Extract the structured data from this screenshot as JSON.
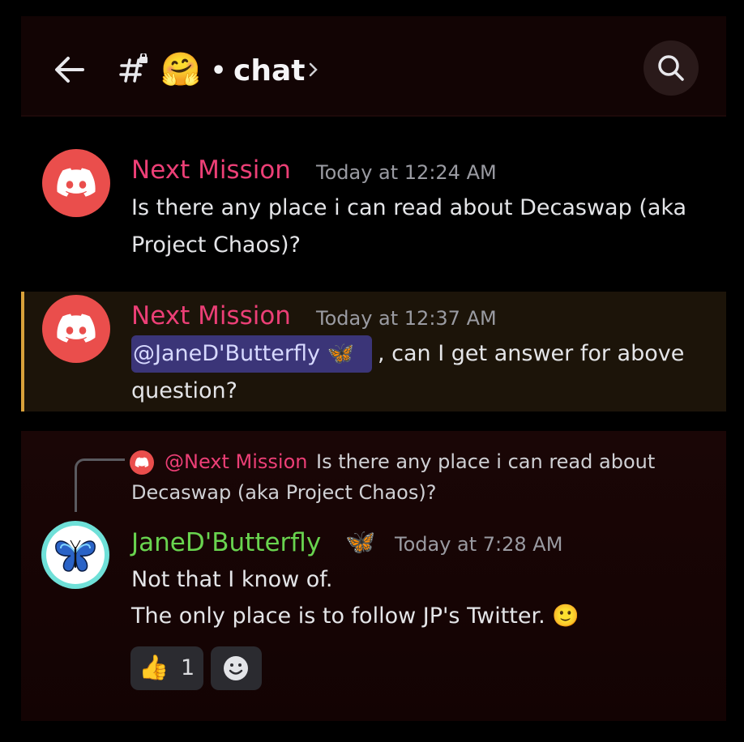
{
  "header": {
    "back_icon": "arrow-left-icon",
    "channel_icon": "hash-lock-icon",
    "channel_emoji": "🤗",
    "separator": "•",
    "channel_name": "chat",
    "chevron_icon": "chevron-right-icon",
    "search_icon": "search-icon"
  },
  "messages": [
    {
      "author": "Next Mission",
      "timestamp": "Today at 12:24 AM",
      "lines": [
        "Is there any place i can read about Decaswap (aka",
        "Project Chaos)?"
      ]
    },
    {
      "author": "Next Mission",
      "timestamp": "Today at 12:37 AM",
      "mention": "@JaneD'Butterfly 🦋",
      "line1_rest": ", can I get answer for above",
      "line2": "question?"
    },
    {
      "reply": {
        "author": "@Next Mission",
        "line1": "Is there any place i can read about",
        "line2": "Decaswap (aka Project Chaos)?"
      },
      "author": "JaneD'Butterfly",
      "author_emoji": "🦋",
      "timestamp": "Today at 7:28 AM",
      "lines": [
        "Not that I know of.",
        "The only place is to follow JP's Twitter. 🙂"
      ],
      "reactions": [
        {
          "emoji": "👍",
          "count": "1"
        },
        {
          "icon": "add-reaction-icon"
        }
      ]
    }
  ],
  "colors": {
    "accent_red": "#ec3f76",
    "accent_green": "#69d44f",
    "avatar_red": "#ea4e4c",
    "highlight_bar": "#d9a13a",
    "mention_bg": "#3b3578"
  }
}
